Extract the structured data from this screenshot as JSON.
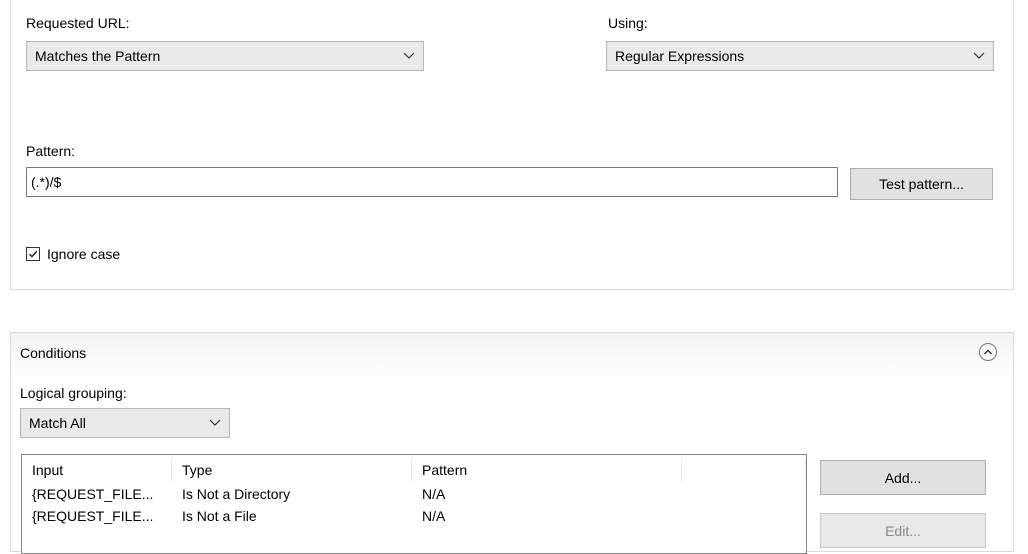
{
  "match": {
    "requested_url_label": "Requested URL:",
    "requested_url_value": "Matches the Pattern",
    "using_label": "Using:",
    "using_value": "Regular Expressions",
    "pattern_label": "Pattern:",
    "pattern_value": "(.*)/$",
    "test_pattern_label": "Test pattern...",
    "ignore_case_label": "Ignore case",
    "ignore_case_checked": true
  },
  "conditions": {
    "title": "Conditions",
    "logical_grouping_label": "Logical grouping:",
    "logical_grouping_value": "Match All",
    "columns": [
      "Input",
      "Type",
      "Pattern",
      ""
    ],
    "rows": [
      {
        "input": "{REQUEST_FILE...",
        "type": "Is Not a Directory",
        "pattern": "N/A"
      },
      {
        "input": "{REQUEST_FILE...",
        "type": "Is Not a File",
        "pattern": "N/A"
      }
    ],
    "add_label": "Add...",
    "edit_label": "Edit..."
  },
  "icons": {
    "dropdown": "chevron-down-icon",
    "collapse": "collapse-up-icon",
    "check": "checkmark-icon"
  },
  "colors": {
    "combo_bg": "#e9e9e9",
    "button_bg": "#e1e1e1",
    "disabled_text": "#8a8a8a",
    "border": "#b5b5b5"
  }
}
